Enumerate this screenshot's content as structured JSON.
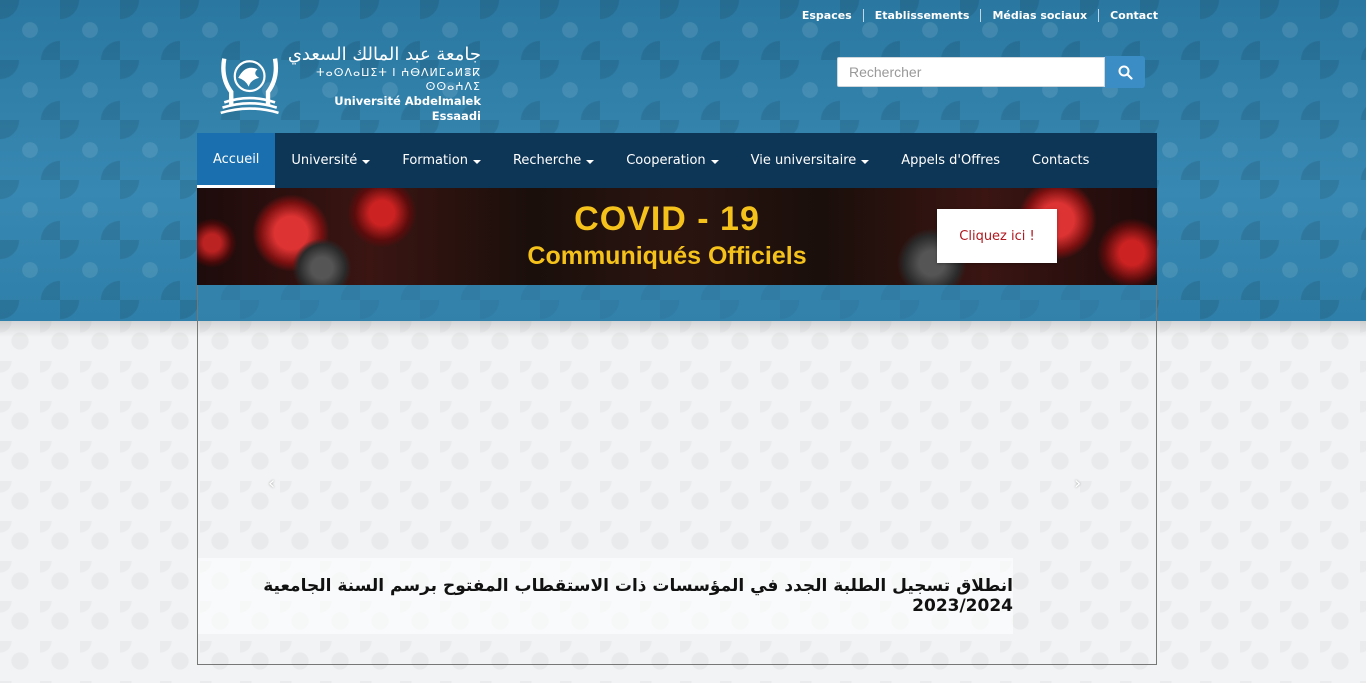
{
  "top_links": [
    "Espaces",
    "Etablissements",
    "Médias sociaux",
    "Contact"
  ],
  "logo": {
    "arabic": "جامعة عبد المالك السعدي",
    "tifinagh": "ⵜⴰⵙⴷⴰⵡⵉⵜ ⵏ ⵄⴱⴷⵍⵎⴰⵍⴻⴽ ⵙⵙⴰⵄⴷⵉ",
    "french": "Université Abdelmalek Essaadi"
  },
  "search": {
    "placeholder": "Rechercher",
    "icon": "search-icon"
  },
  "nav": {
    "items": [
      {
        "label": "Accueil",
        "active": true,
        "dropdown": false
      },
      {
        "label": "Université",
        "active": false,
        "dropdown": true
      },
      {
        "label": "Formation",
        "active": false,
        "dropdown": true
      },
      {
        "label": "Recherche",
        "active": false,
        "dropdown": true
      },
      {
        "label": "Cooperation",
        "active": false,
        "dropdown": true
      },
      {
        "label": "Vie universitaire",
        "active": false,
        "dropdown": true
      },
      {
        "label": "Appels d'Offres",
        "active": false,
        "dropdown": false
      },
      {
        "label": "Contacts",
        "active": false,
        "dropdown": false
      }
    ]
  },
  "covid_banner": {
    "title": "COVID - 19",
    "subtitle": "Communiqués Officiels",
    "button": "Cliquez ici !"
  },
  "slider": {
    "caption": "انطلاق تسجيل الطلبة الجدد في المؤسسات ذات الاستقطاب المفتوح برسم السنة الجامعية 2023/2024",
    "prev_icon": "chevron-left-icon",
    "next_icon": "chevron-right-icon"
  },
  "colors": {
    "header_blue": "#2f7fa8",
    "nav_bg": "#0d3556",
    "nav_active": "#1a6faf",
    "search_button": "#3b8dc6",
    "covid_yellow": "#f5c21b",
    "covid_button_text": "#b0171e"
  }
}
